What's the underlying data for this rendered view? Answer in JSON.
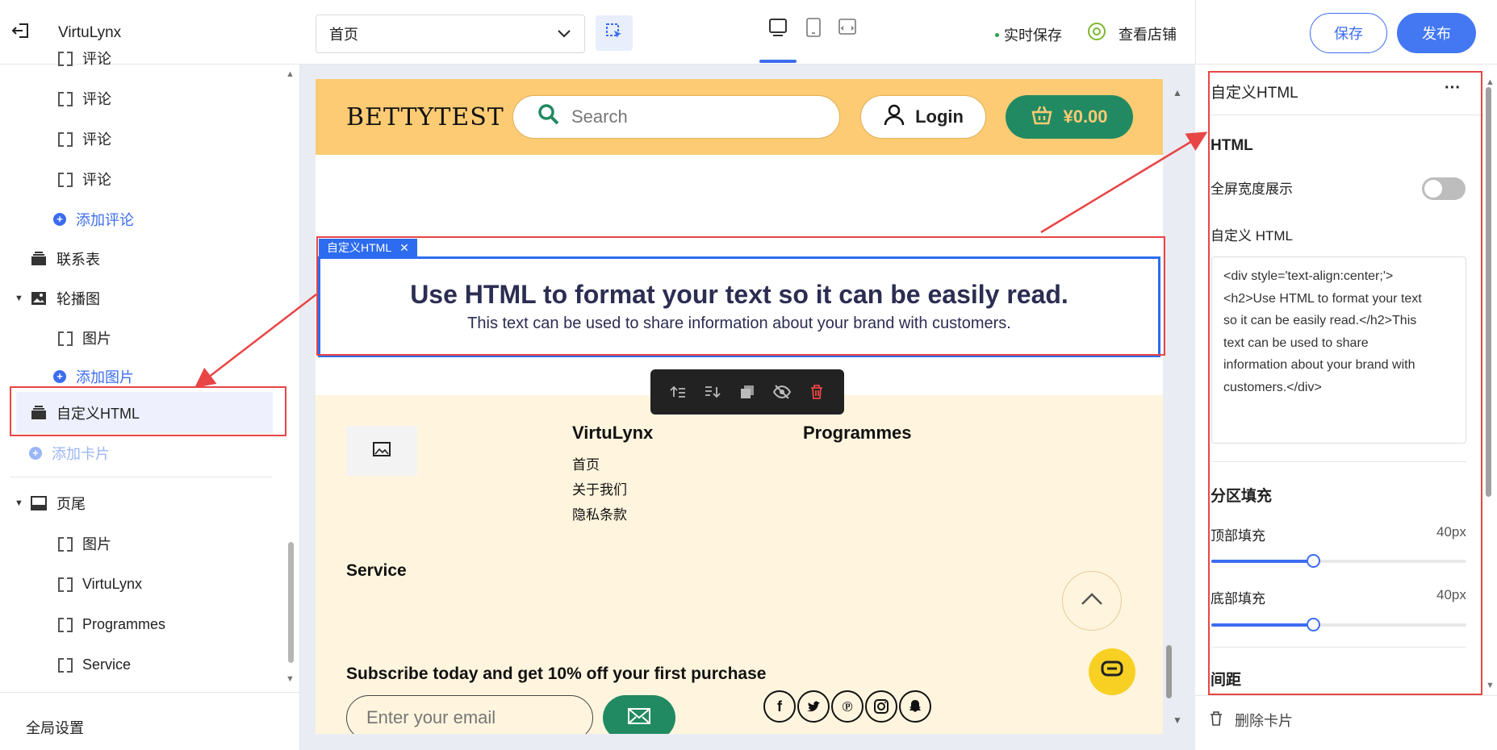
{
  "topbar": {
    "app_name": "VirtuLynx",
    "page_select_value": "首页",
    "autosave_label": "实时保存",
    "view_store_label": "查看店铺",
    "save_label": "保存",
    "publish_label": "发布"
  },
  "left_panel": {
    "items": [
      {
        "label": "评论"
      },
      {
        "label": "评论"
      },
      {
        "label": "评论"
      },
      {
        "label": "评论"
      }
    ],
    "add_review": "添加评论",
    "contact_form": "联系表",
    "carousel": "轮播图",
    "carousel_image": "图片",
    "add_image": "添加图片",
    "custom_html": "自定义HTML",
    "add_card": "添加卡片",
    "footer": "页尾",
    "footer_items": [
      {
        "label": "图片"
      },
      {
        "label": "VirtuLynx"
      },
      {
        "label": "Programmes"
      },
      {
        "label": "Service"
      }
    ],
    "global_settings": "全局设置"
  },
  "site": {
    "brand": "BETTYTEST",
    "search_placeholder": "Search",
    "login": "Login",
    "cart": "¥0.00",
    "html_badge": "自定义HTML",
    "html_heading": "Use HTML to format your text so it can be easily read.",
    "html_paragraph": "This text can be used to share information about your brand with customers.",
    "footer": {
      "col1_title": "VirtuLynx",
      "col1_links": [
        "首页",
        "关于我们",
        "隐私条款"
      ],
      "col2_title": "Programmes",
      "service_title": "Service",
      "subscribe_title": "Subscribe today and get 10% off your first purchase",
      "email_placeholder": "Enter your email",
      "social": [
        "f",
        "t",
        "p",
        "ig",
        "sc"
      ]
    }
  },
  "right_panel": {
    "title": "自定义HTML",
    "more": "···",
    "html_heading": "HTML",
    "fullwidth_label": "全屏宽度展示",
    "custom_html_label": "自定义 HTML",
    "code": "<div style='text-align:center;'>\n<h2>Use HTML to format your text\nso it can be easily read.</h2>This\ntext can be used to share\ninformation about your brand with\ncustomers.</div>",
    "padding_heading": "分区填充",
    "top_padding_label": "顶部填充",
    "top_padding_value": "40px",
    "top_padding_fraction": 0.4,
    "bottom_padding_label": "底部填充",
    "bottom_padding_value": "40px",
    "bottom_padding_fraction": 0.4,
    "spacing_heading": "间距",
    "delete_card": "删除卡片"
  },
  "colors": {
    "accent": "#3c6df0",
    "header_bg": "#fccb73",
    "footer_bg": "#fff5de",
    "cart_green": "#218a62",
    "highlight_red": "#e84545"
  }
}
